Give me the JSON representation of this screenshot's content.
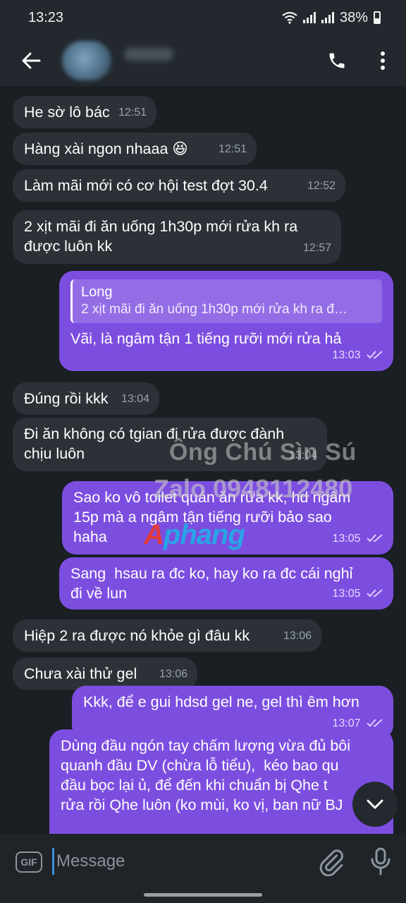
{
  "status_bar": {
    "time": "13:23",
    "battery": "38%"
  },
  "header": {
    "back_icon": "arrow-left-icon",
    "call_icon": "phone-icon",
    "menu_icon": "more-vert-icon"
  },
  "watermark": {
    "line1": "Ông Chú Sìn Sú",
    "line2": "Zalo 0948112480",
    "logo_a": "A",
    "logo_rest": "phang"
  },
  "messages": [
    {
      "dir": "in",
      "text": "He sờ lô bác",
      "time": "12:51"
    },
    {
      "dir": "in",
      "text": "Hàng xài ngon nhaaa 😆",
      "time": "12:51"
    },
    {
      "dir": "in",
      "text": "Làm mãi mới có cơ hội test đợt 30.4",
      "time": "12:52"
    },
    {
      "dir": "in",
      "text": "2 xịt mãi đi ăn uống 1h30p mới rửa kh ra\nđược luôn kk",
      "time": "12:57"
    },
    {
      "dir": "out",
      "quote_author": "Long",
      "quote_text": "2 xịt mãi đi ăn uống 1h30p mới rửa kh ra đ…",
      "text": "Vãi, là ngâm tận 1 tiếng rưỡi mới rửa hả",
      "time": "13:03"
    },
    {
      "dir": "in",
      "text": "Đúng rồi kkk",
      "time": "13:04"
    },
    {
      "dir": "in",
      "text": "Đi ăn không có tgian đi rửa được đành\nchịu luôn",
      "time": "13:04"
    },
    {
      "dir": "out",
      "text": "Sao ko vô toilet quán ăn rửa kk, hd ngâm\n15p mà a ngâm tận tiếng rưỡi bảo sao\nhaha",
      "time": "13:05"
    },
    {
      "dir": "out",
      "text": "Sang  hsau ra đc ko, hay ko ra đc cái nghỉ\nđi về lun",
      "time": "13:05"
    },
    {
      "dir": "in",
      "text": "Hiệp 2 ra được nó khỏe gì đâu kk",
      "time": "13:06"
    },
    {
      "dir": "in",
      "text": "Chưa xài thử gel",
      "time": "13:06"
    },
    {
      "dir": "out",
      "text": "Kkk, để e gui hdsd gel ne, gel thì êm hơn",
      "time": "13:07"
    },
    {
      "dir": "out",
      "text": "Dùng đầu ngón tay chấm lượng vừa đủ bôi\nquanh đầu DV (chừa lỗ tiểu),  kéo bao qu\nđầu bọc lại ủ, để đến khi chuẩn bị Qhe t\nrửa rồi Qhe luôn (ko mùi, ko vị, ban nữ BJ",
      "time": ""
    }
  ],
  "composer": {
    "gif_label": "GIF",
    "placeholder": "Message",
    "attach_icon": "paperclip-icon",
    "mic_icon": "microphone-icon"
  },
  "fab_icon": "chevron-down-icon"
}
